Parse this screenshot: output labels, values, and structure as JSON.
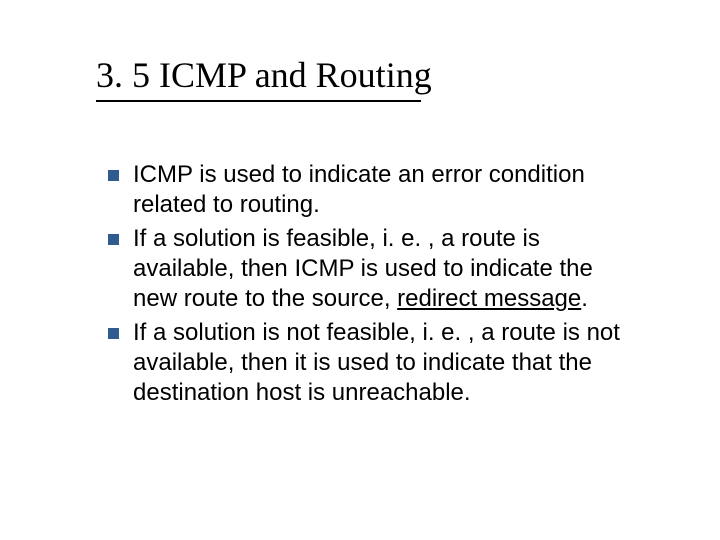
{
  "title": "3. 5 ICMP and Routing",
  "bullets": [
    {
      "text": "ICMP is used to indicate an error condition related to routing."
    },
    {
      "pre": "If a solution is feasible, i. e. , a route is available, then ICMP is used to indicate the new route to the source, ",
      "ul": "redirect message",
      "post": "."
    },
    {
      "text": "If a solution is not feasible, i. e. , a route is not available, then it is used to indicate that the destination host is unreachable."
    }
  ]
}
